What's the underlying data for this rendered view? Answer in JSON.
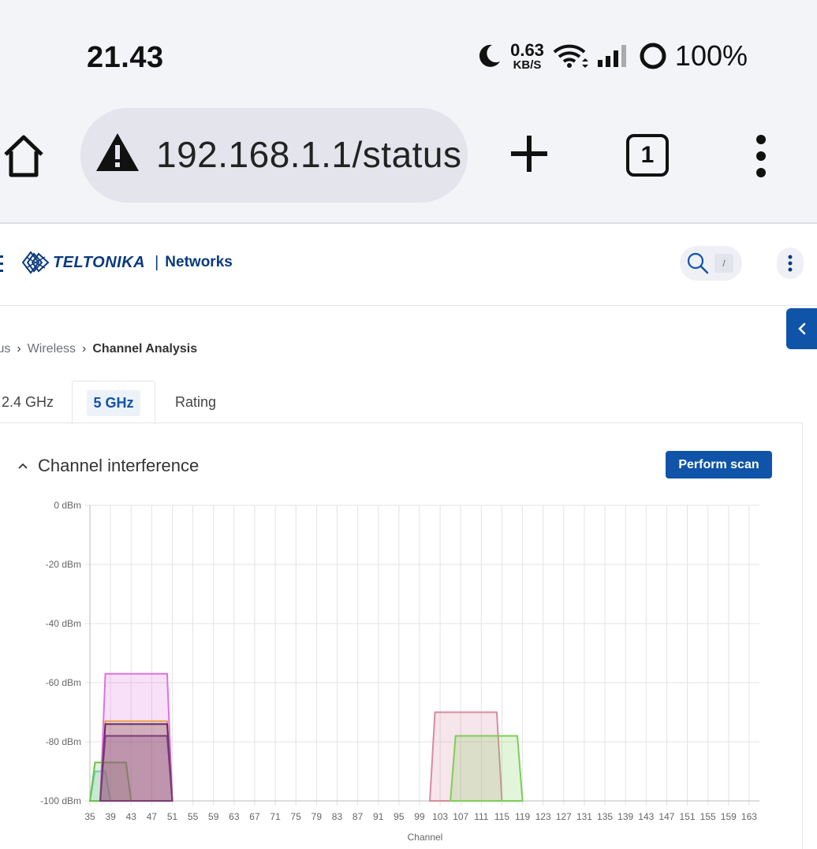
{
  "status_bar": {
    "time": "21.43",
    "data_rate_value": "0.63",
    "data_rate_unit": "KB/S",
    "battery": "100%",
    "icons": [
      "moon-icon",
      "wifi-icon",
      "signal-icon",
      "battery-ring-icon"
    ]
  },
  "browser": {
    "url": "192.168.1.1/status",
    "tab_count": "1",
    "icons": [
      "home-icon",
      "warning-icon",
      "plus-icon",
      "tabs-icon",
      "kebab-menu-icon"
    ]
  },
  "app_header": {
    "brand": "TELTONIKA",
    "separator": "|",
    "product": "Networks",
    "search_shortcut": "/",
    "brand_color": "#0b3a7e"
  },
  "breadcrumb": {
    "items": [
      "Status",
      "Wireless",
      "Channel Analysis"
    ]
  },
  "tabs": [
    {
      "label": "2.4 GHz",
      "active": false
    },
    {
      "label": "5 GHz",
      "active": true
    },
    {
      "label": "Rating",
      "active": false
    }
  ],
  "section": {
    "title": "Channel interference",
    "scan_button": "Perform scan",
    "accent_color": "#0f54a8"
  },
  "chart_data": {
    "type": "area",
    "title": "",
    "xlabel": "Channel",
    "ylabel": "",
    "y_unit": "dBm",
    "ylim": [
      -100,
      0
    ],
    "yticks": [
      "0 dBm",
      "-20 dBm",
      "-40 dBm",
      "-60 dBm",
      "-80 dBm",
      "-100 dBm"
    ],
    "xlim": [
      35,
      165
    ],
    "xticks": [
      35,
      39,
      43,
      47,
      51,
      55,
      59,
      63,
      67,
      71,
      75,
      79,
      83,
      87,
      91,
      95,
      99,
      103,
      107,
      111,
      115,
      119,
      123,
      127,
      131,
      135,
      139,
      143,
      147,
      151,
      155,
      159,
      163
    ],
    "grid": true,
    "series": [
      {
        "channel_start": 36,
        "channel_end": 38,
        "signal": -90,
        "color": "#6fd3d3"
      },
      {
        "channel_start": 36,
        "channel_end": 42,
        "signal": -87,
        "color": "#6bc24a"
      },
      {
        "channel_start": 38,
        "channel_end": 50,
        "signal": -57,
        "color": "#e070e0"
      },
      {
        "channel_start": 38,
        "channel_end": 50,
        "signal": -73,
        "color": "#e8a050"
      },
      {
        "channel_start": 38,
        "channel_end": 50,
        "signal": -74,
        "color": "#5a2a6a"
      },
      {
        "channel_start": 38,
        "channel_end": 50,
        "signal": -78,
        "color": "#7a3a7a"
      },
      {
        "channel_start": 102,
        "channel_end": 114,
        "signal": -70,
        "color": "#d88aa0"
      },
      {
        "channel_start": 106,
        "channel_end": 118,
        "signal": -78,
        "color": "#7ccf55"
      }
    ]
  }
}
